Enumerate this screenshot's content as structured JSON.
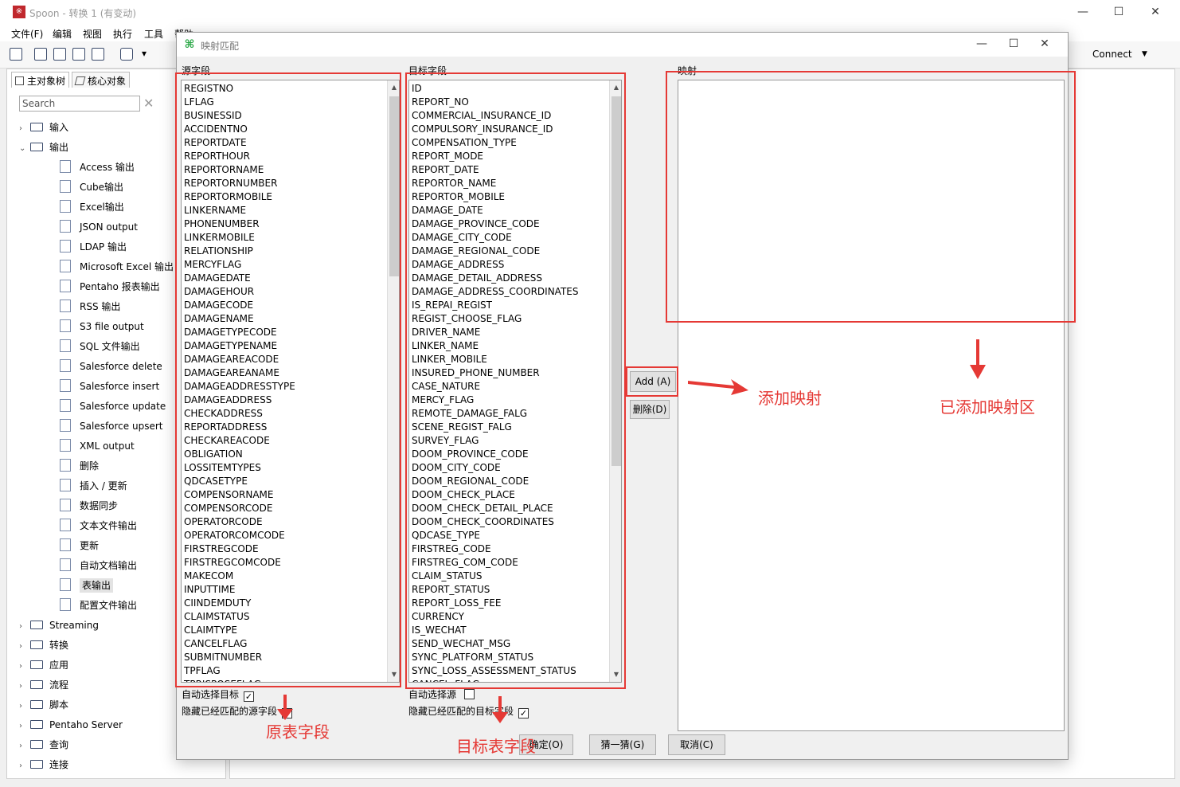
{
  "window": {
    "logo": "※",
    "title": "Spoon - 转换 1 (有变动)",
    "minimize": "—",
    "maximize": "☐",
    "close": "✕"
  },
  "menu": [
    "文件(F)",
    "编辑",
    "视图",
    "执行",
    "工具",
    "帮助"
  ],
  "toolbar": {
    "connect_label": "Connect",
    "connect_arrow": "▼",
    "layers_arrow": "▾"
  },
  "left_panel": {
    "tabs": [
      "主对象树",
      "核心对象"
    ],
    "search_placeholder": "Search",
    "search_clear": "✕",
    "tree": [
      {
        "label": "输入",
        "type": "folder",
        "expanded": false
      },
      {
        "label": "输出",
        "type": "folder",
        "expanded": true
      },
      {
        "label": "Access 输出",
        "type": "leaf"
      },
      {
        "label": "Cube输出",
        "type": "leaf"
      },
      {
        "label": "Excel输出",
        "type": "leaf"
      },
      {
        "label": "JSON output",
        "type": "leaf"
      },
      {
        "label": "LDAP 输出",
        "type": "leaf"
      },
      {
        "label": "Microsoft Excel 输出",
        "type": "leaf"
      },
      {
        "label": "Pentaho 报表输出",
        "type": "leaf"
      },
      {
        "label": "RSS 输出",
        "type": "leaf"
      },
      {
        "label": "S3 file output",
        "type": "leaf"
      },
      {
        "label": "SQL 文件输出",
        "type": "leaf"
      },
      {
        "label": "Salesforce delete",
        "type": "leaf"
      },
      {
        "label": "Salesforce insert",
        "type": "leaf"
      },
      {
        "label": "Salesforce update",
        "type": "leaf"
      },
      {
        "label": "Salesforce upsert",
        "type": "leaf"
      },
      {
        "label": "XML output",
        "type": "leaf"
      },
      {
        "label": "删除",
        "type": "leaf"
      },
      {
        "label": "插入 / 更新",
        "type": "leaf"
      },
      {
        "label": "数据同步",
        "type": "leaf"
      },
      {
        "label": "文本文件输出",
        "type": "leaf"
      },
      {
        "label": "更新",
        "type": "leaf"
      },
      {
        "label": "自动文档输出",
        "type": "leaf"
      },
      {
        "label": "表输出",
        "type": "leaf",
        "selected": true
      },
      {
        "label": "配置文件输出",
        "type": "leaf"
      },
      {
        "label": "Streaming",
        "type": "folder",
        "expanded": false
      },
      {
        "label": "转换",
        "type": "folder",
        "expanded": false
      },
      {
        "label": "应用",
        "type": "folder",
        "expanded": false
      },
      {
        "label": "流程",
        "type": "folder",
        "expanded": false
      },
      {
        "label": "脚本",
        "type": "folder",
        "expanded": false
      },
      {
        "label": "Pentaho Server",
        "type": "folder",
        "expanded": false
      },
      {
        "label": "查询",
        "type": "folder",
        "expanded": false
      },
      {
        "label": "连接",
        "type": "folder",
        "expanded": false
      }
    ]
  },
  "dialog": {
    "title": "映射匹配",
    "icon": "⌘",
    "minimize": "—",
    "maximize": "☐",
    "close": "✕",
    "source_label": "源字段",
    "target_label": "目标字段",
    "mapping_label": "映射",
    "source_fields": [
      "REGISTNO",
      "LFLAG",
      "BUSINESSID",
      "ACCIDENTNO",
      "REPORTDATE",
      "REPORTHOUR",
      "REPORTORNAME",
      "REPORTORNUMBER",
      "REPORTORMOBILE",
      "LINKERNAME",
      "PHONENUMBER",
      "LINKERMOBILE",
      "RELATIONSHIP",
      "MERCYFLAG",
      "DAMAGEDATE",
      "DAMAGEHOUR",
      "DAMAGECODE",
      "DAMAGENAME",
      "DAMAGETYPECODE",
      "DAMAGETYPENAME",
      "DAMAGEAREACODE",
      "DAMAGEAREANAME",
      "DAMAGEADDRESSTYPE",
      "DAMAGEADDRESS",
      "CHECKADDRESS",
      "REPORTADDRESS",
      "CHECKAREACODE",
      "OBLIGATION",
      "LOSSITEMTYPES",
      "QDCASETYPE",
      "COMPENSORNAME",
      "COMPENSORCODE",
      "OPERATORCODE",
      "OPERATORCOMCODE",
      "FIRSTREGCODE",
      "FIRSTREGCOMCODE",
      "MAKECOM",
      "INPUTTIME",
      "CIINDEMDUTY",
      "CLAIMSTATUS",
      "CLAIMTYPE",
      "CANCELFLAG",
      "SUBMITNUMBER",
      "TPFLAG",
      "TPRISPOSEFLAG"
    ],
    "target_fields": [
      "ID",
      "REPORT_NO",
      "COMMERCIAL_INSURANCE_ID",
      "COMPULSORY_INSURANCE_ID",
      "COMPENSATION_TYPE",
      "REPORT_MODE",
      "REPORT_DATE",
      "REPORTOR_NAME",
      "REPORTOR_MOBILE",
      "DAMAGE_DATE",
      "DAMAGE_PROVINCE_CODE",
      "DAMAGE_CITY_CODE",
      "DAMAGE_REGIONAL_CODE",
      "DAMAGE_ADDRESS",
      "DAMAGE_DETAIL_ADDRESS",
      "DAMAGE_ADDRESS_COORDINATES",
      "IS_REPAI_REGIST",
      "REGIST_CHOOSE_FLAG",
      "DRIVER_NAME",
      "LINKER_NAME",
      "LINKER_MOBILE",
      "INSURED_PHONE_NUMBER",
      "CASE_NATURE",
      "MERCY_FLAG",
      "REMOTE_DAMAGE_FALG",
      "SCENE_REGIST_FALG",
      "SURVEY_FLAG",
      "DOOM_PROVINCE_CODE",
      "DOOM_CITY_CODE",
      "DOOM_REGIONAL_CODE",
      "DOOM_CHECK_PLACE",
      "DOOM_CHECK_DETAIL_PLACE",
      "DOOM_CHECK_COORDINATES",
      "QDCASE_TYPE",
      "FIRSTREG_CODE",
      "FIRSTREG_COM_CODE",
      "CLAIM_STATUS",
      "REPORT_STATUS",
      "REPORT_LOSS_FEE",
      "CURRENCY",
      "IS_WECHAT",
      "SEND_WECHAT_MSG",
      "SYNC_PLATFORM_STATUS",
      "SYNC_LOSS_ASSESSMENT_STATUS",
      "CANCEL_FLAG"
    ],
    "auto_select_target": "自动选择目标",
    "auto_select_target_checked": true,
    "hide_matched_source": "隐藏已经匹配的源字段",
    "hide_matched_source_checked": true,
    "auto_select_source": "自动选择源",
    "auto_select_source_checked": false,
    "hide_matched_target": "隐藏已经匹配的目标字段",
    "hide_matched_target_checked": true,
    "add_button": "Add (A)",
    "delete_button": "删除(D)",
    "ok_button": "确定(O)",
    "guess_button": "猜一猜(G)",
    "cancel_button": "取消(C)",
    "check_mark": "✓",
    "scroll_up": "▲",
    "scroll_down": "▼"
  },
  "annotations": {
    "add_mapping": "添加映射",
    "added_area": "已添加映射区",
    "source_table_fields": "原表字段",
    "target_table_fields": "目标表字段"
  },
  "colors": {
    "annotation_red": "#e53935",
    "accent_green": "#28a745",
    "logo_red": "#c0282d"
  }
}
